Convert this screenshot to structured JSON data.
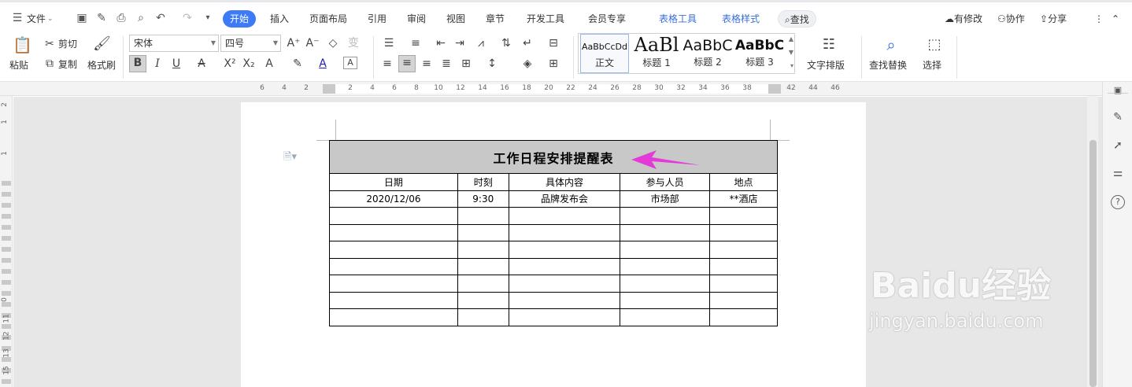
{
  "menu": {
    "file": "文件",
    "tabs": [
      "开始",
      "插入",
      "页面布局",
      "引用",
      "审阅",
      "视图",
      "章节",
      "开发工具",
      "会员专享",
      "表格工具",
      "表格样式"
    ],
    "search": "查找",
    "right": {
      "modified": "有修改",
      "collab": "协作",
      "share": "分享"
    }
  },
  "ribbon": {
    "paste": "粘贴",
    "cut": "剪切",
    "copy": "复制",
    "format_painter": "格式刷",
    "font_name": "宋体",
    "font_size": "四号",
    "styles": [
      {
        "sample": "AaBbCcDd",
        "name": "正文"
      },
      {
        "sample": "AaBl",
        "name": "标题 1"
      },
      {
        "sample": "AaBbC",
        "name": "标题 2"
      },
      {
        "sample": "AaBbC",
        "name": "标题 3"
      }
    ],
    "text_layout": "文字排版",
    "find_replace": "查找替换",
    "select": "选择"
  },
  "ruler": {
    "h_ticks": [
      "6",
      "4",
      "2",
      "2",
      "4",
      "6",
      "8",
      "10",
      "12",
      "14",
      "16",
      "18",
      "20",
      "22",
      "24",
      "26",
      "28",
      "30",
      "32",
      "34",
      "36",
      "38",
      "42",
      "44",
      "46"
    ],
    "v_ticks": [
      "2",
      "1",
      "1",
      "0",
      "11",
      "12",
      "13",
      "15"
    ]
  },
  "table": {
    "title": "工作日程安排提醒表",
    "headers": [
      "日期",
      "时刻",
      "具体内容",
      "参与人员",
      "地点"
    ],
    "rows": [
      [
        "2020/12/06",
        "9:30",
        "品牌发布会",
        "市场部",
        "**酒店"
      ],
      [
        "",
        "",
        "",
        "",
        ""
      ],
      [
        "",
        "",
        "",
        "",
        ""
      ],
      [
        "",
        "",
        "",
        "",
        ""
      ],
      [
        "",
        "",
        "",
        "",
        ""
      ],
      [
        "",
        "",
        "",
        "",
        ""
      ],
      [
        "",
        "",
        "",
        "",
        ""
      ],
      [
        "",
        "",
        "",
        "",
        ""
      ]
    ]
  },
  "watermark": {
    "brand": "Baidu经验",
    "url": "jingyan.baidu.com"
  },
  "colors": {
    "accent": "#3d7af5",
    "arrow": "#e43ad8",
    "title_bg": "#c8c8c8"
  },
  "icons": [
    "menu-icon",
    "save-icon",
    "undo-icon",
    "redo-icon",
    "print-icon",
    "search-icon",
    "share-icon",
    "pen-icon",
    "pointer-icon",
    "sliders-icon",
    "help-icon"
  ]
}
